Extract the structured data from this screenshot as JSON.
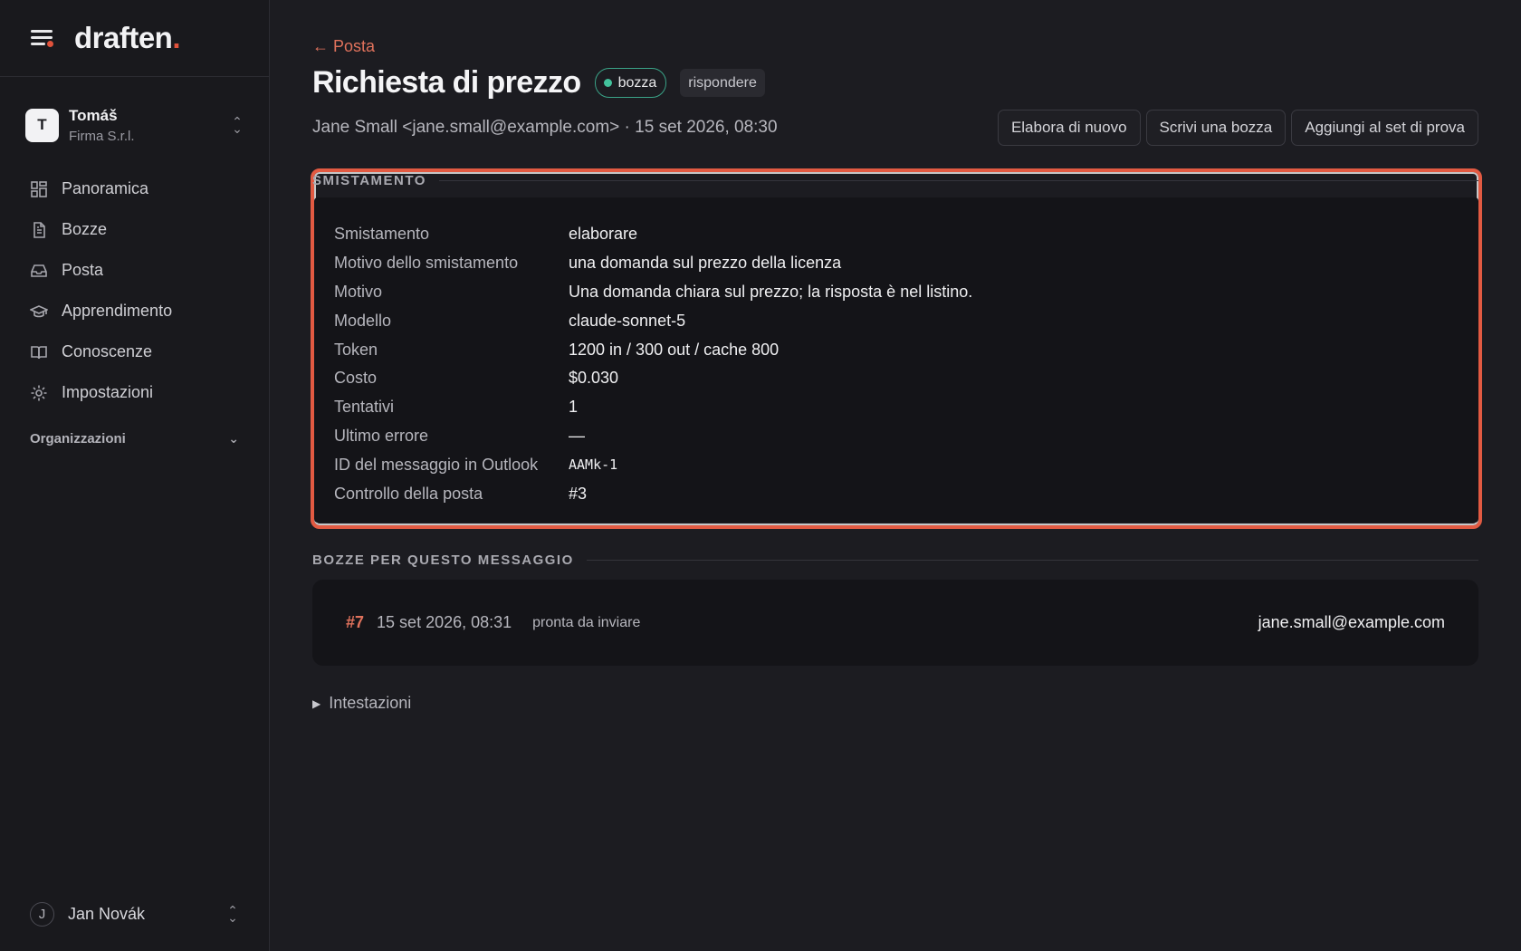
{
  "brand": {
    "name": "draften",
    "dot": "."
  },
  "org": {
    "initial": "T",
    "name": "Tomáš",
    "company": "Firma S.r.l."
  },
  "nav": [
    {
      "label": "Panoramica",
      "icon": "dashboard-icon"
    },
    {
      "label": "Bozze",
      "icon": "document-icon"
    },
    {
      "label": "Posta",
      "icon": "inbox-icon"
    },
    {
      "label": "Apprendimento",
      "icon": "graduation-cap-icon"
    },
    {
      "label": "Conoscenze",
      "icon": "book-icon"
    },
    {
      "label": "Impostazioni",
      "icon": "gear-icon"
    }
  ],
  "organizations_label": "Organizzazioni",
  "user": {
    "initial": "J",
    "name": "Jan Novák"
  },
  "back_link": "← Posta",
  "title": "Richiesta di prezzo",
  "status_badge": "bozza",
  "tag_badge": "rispondere",
  "meta": "Jane Small <jane.small@example.com> · 15 set 2026, 08:30",
  "actions": {
    "reprocess": "Elabora di nuovo",
    "write_draft": "Scrivi una bozza",
    "add_test_set": "Aggiungi al set di prova"
  },
  "triage": {
    "heading": "SMISTAMENTO",
    "rows": [
      {
        "key": "Smistamento",
        "value": "elaborare"
      },
      {
        "key": "Motivo dello smistamento",
        "value": "una domanda sul prezzo della licenza"
      },
      {
        "key": "Motivo",
        "value": "Una domanda chiara sul prezzo; la risposta è nel listino."
      },
      {
        "key": "Modello",
        "value": "claude-sonnet-5"
      },
      {
        "key": "Token",
        "value": "1200 in / 300 out / cache 800"
      },
      {
        "key": "Costo",
        "value": "$0.030"
      },
      {
        "key": "Tentativi",
        "value": "1"
      },
      {
        "key": "Ultimo errore",
        "value": "—"
      },
      {
        "key": "ID del messaggio in Outlook",
        "value": "AAMk-1"
      },
      {
        "key": "Controllo della posta",
        "value": "#3"
      }
    ]
  },
  "drafts": {
    "heading": "BOZZE PER QUESTO MESSAGGIO",
    "items": [
      {
        "id": "#7",
        "date": "15 set 2026, 08:31",
        "status": "pronta da inviare",
        "to": "jane.small@example.com"
      }
    ]
  },
  "headers_toggle": "Intestazioni",
  "colors": {
    "accent": "#e0523b",
    "status_green": "#43c29c",
    "background": "#1c1c21"
  }
}
